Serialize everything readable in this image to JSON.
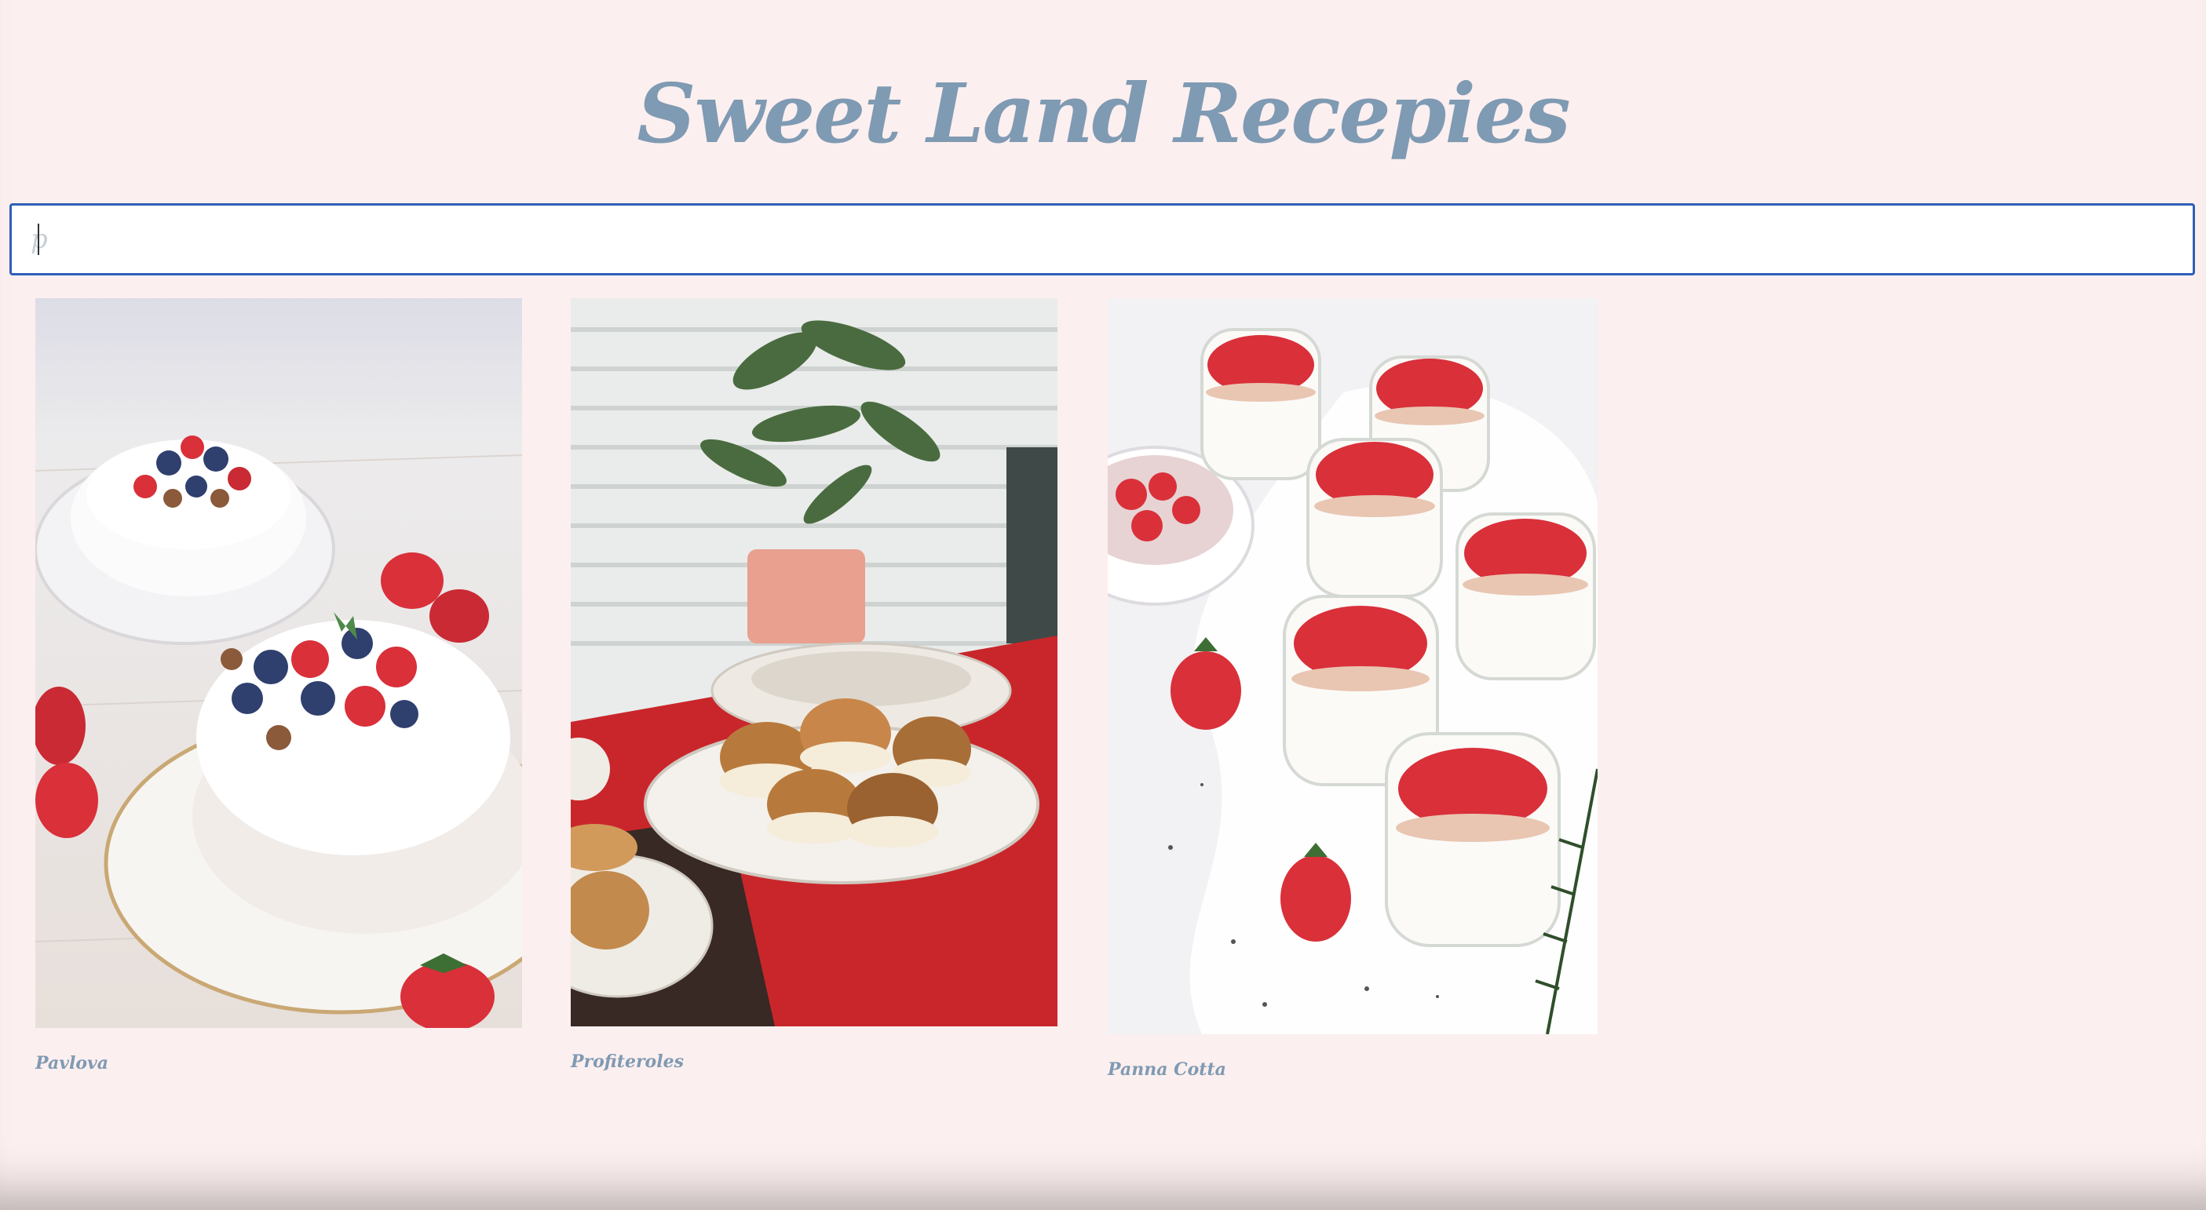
{
  "header": {
    "title": "Sweet Land Recepies"
  },
  "search": {
    "value": "p",
    "placeholder": ""
  },
  "recipes": [
    {
      "name": "Pavlova",
      "image": "pavlova-photo"
    },
    {
      "name": "Profiteroles",
      "image": "profiteroles-photo"
    },
    {
      "name": "Panna Cotta",
      "image": "panna-cotta-photo"
    }
  ],
  "colors": {
    "background": "#fcefef",
    "title": "#7f9ab3",
    "search_border": "#2f5fb8",
    "strawberry": "#d9303a",
    "blueberry": "#2f3f6e"
  }
}
